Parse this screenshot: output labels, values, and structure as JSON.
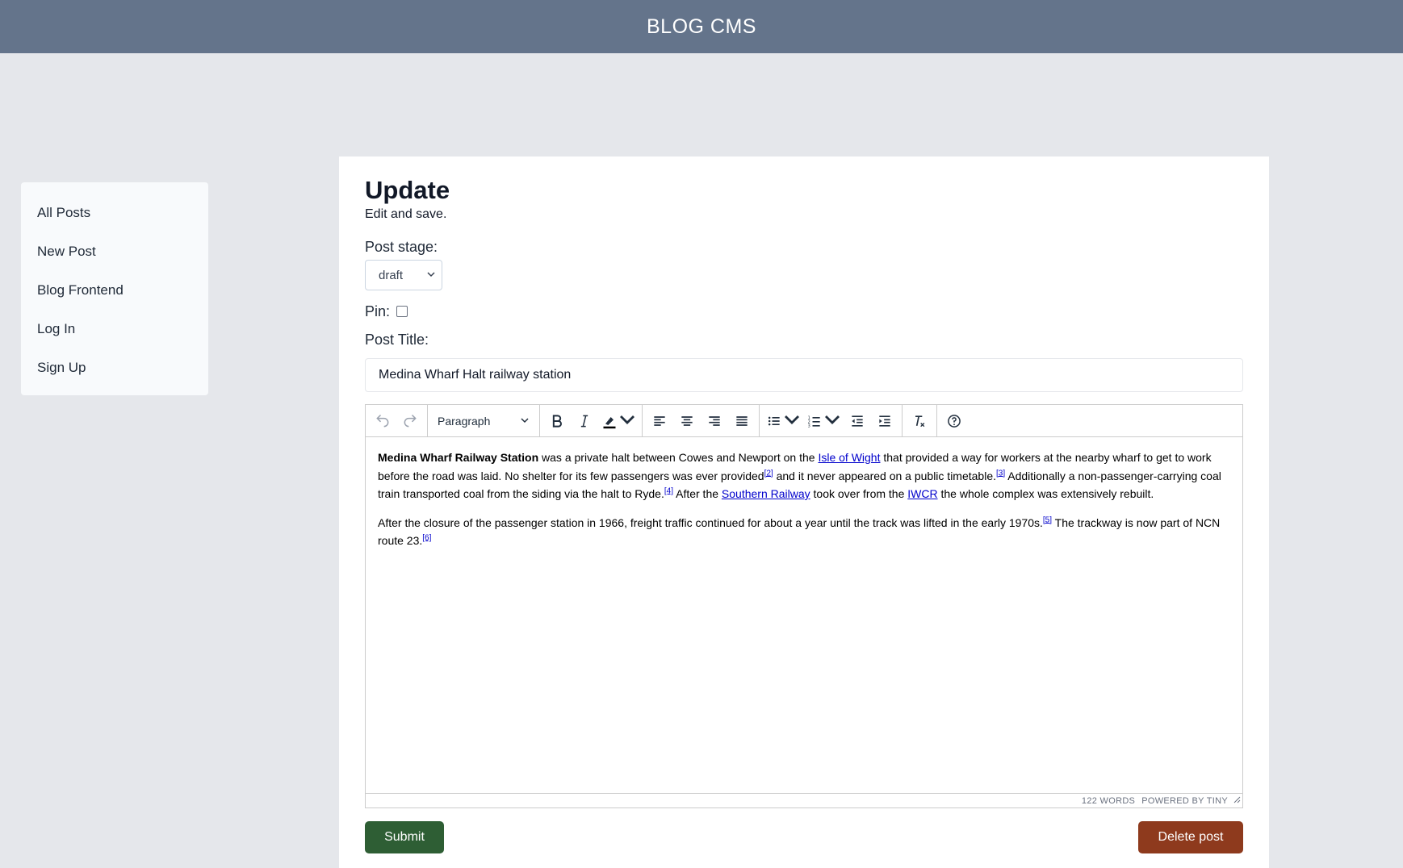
{
  "header": {
    "title": "BLOG CMS"
  },
  "sidebar": {
    "items": [
      {
        "label": "All Posts"
      },
      {
        "label": "New Post"
      },
      {
        "label": "Blog Frontend"
      },
      {
        "label": "Log In"
      },
      {
        "label": "Sign Up"
      }
    ]
  },
  "form": {
    "title": "Update",
    "subtitle": "Edit and save.",
    "stage_label": "Post stage:",
    "stage_value": "draft",
    "pin_label": "Pin:",
    "pin_checked": false,
    "post_title_label": "Post Title:",
    "post_title_value": "Medina Wharf Halt railway station",
    "submit_label": "Submit",
    "delete_label": "Delete post"
  },
  "editor": {
    "block_format": "Paragraph",
    "toolbar_icons": [
      "undo-icon",
      "redo-icon",
      "bold-icon",
      "italic-icon",
      "highlight-icon",
      "align-left-icon",
      "align-center-icon",
      "align-right-icon",
      "align-justify-icon",
      "bullet-list-icon",
      "numbered-list-icon",
      "outdent-icon",
      "indent-icon",
      "clear-formatting-icon",
      "help-icon"
    ],
    "p1": {
      "bold": "Medina Wharf Railway Station",
      "t1": " was a private halt between Cowes and Newport on the ",
      "link1": "Isle of Wight",
      "t2": " that provided a way for workers at the nearby wharf to get to work before the road was laid. No shelter for its few passengers was ever provided",
      "ref2": "[2]",
      "t3": " and it never appeared on a public timetable.",
      "ref3": "[3]",
      "t4": " Additionally a non-passenger-carrying coal train transported coal from the siding via the halt to Ryde.",
      "ref4": "[4]",
      "t5": " After the ",
      "link2": "Southern Railway",
      "t6": " took over from the ",
      "link3": "IWCR",
      "t7": " the whole complex was extensively rebuilt."
    },
    "p2": {
      "t1": "After the closure of the passenger station in 1966, freight traffic continued for about a year until the track was lifted in the early 1970s.",
      "ref5": "[5]",
      "t2": " The trackway is now part of NCN route 23.",
      "ref6": "[6]"
    },
    "word_count": "122 WORDS",
    "powered_by": "POWERED BY TINY"
  },
  "colors": {
    "header_bg": "#64748b",
    "page_bg": "#e5e7eb",
    "submit_bg": "#2e5e34",
    "delete_bg": "#8e3a1d",
    "link": "#0000cc"
  }
}
